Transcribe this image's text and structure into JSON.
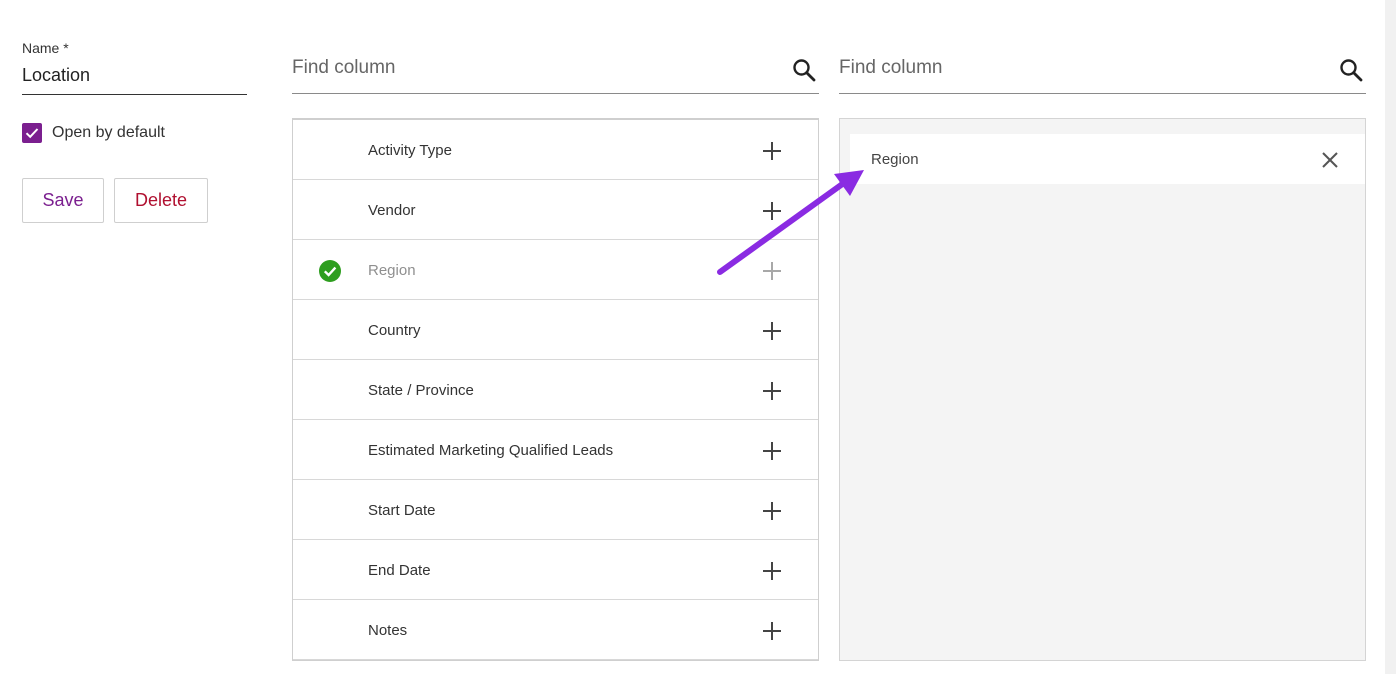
{
  "colors": {
    "accent_purple": "#7b1f8f",
    "delete_red": "#b01030",
    "check_green": "#2e9e1f",
    "arrow_purple": "#8a2be2",
    "icon_gray": "#444444",
    "icon_disabled": "#a8a8a8"
  },
  "form": {
    "name_label": "Name *",
    "name_value": "Location",
    "open_by_default_label": "Open by default",
    "open_by_default_checked": true,
    "save_label": "Save",
    "delete_label": "Delete"
  },
  "available_columns": {
    "search_placeholder": "Find column",
    "search_icon": "search-icon",
    "items": [
      {
        "label": "Activity Type",
        "selected": false
      },
      {
        "label": "Vendor",
        "selected": false
      },
      {
        "label": "Region",
        "selected": true
      },
      {
        "label": "Country",
        "selected": false
      },
      {
        "label": "State / Province",
        "selected": false
      },
      {
        "label": "Estimated Marketing Qualified Leads",
        "selected": false
      },
      {
        "label": "Start Date",
        "selected": false
      },
      {
        "label": "End Date",
        "selected": false
      },
      {
        "label": "Notes",
        "selected": false
      }
    ]
  },
  "selected_columns": {
    "search_placeholder": "Find column",
    "search_icon": "search-icon",
    "items": [
      {
        "label": "Region"
      }
    ]
  }
}
